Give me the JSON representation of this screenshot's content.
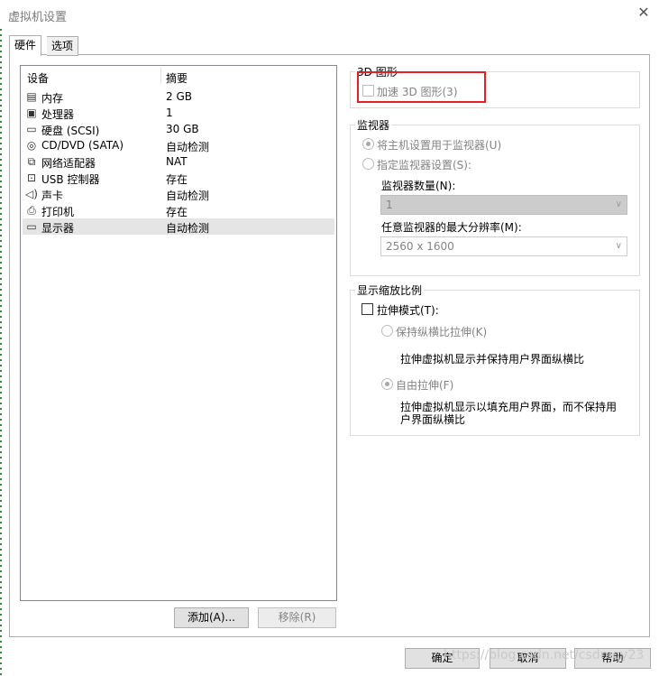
{
  "window": {
    "title": "虚拟机设置"
  },
  "tabs": [
    "硬件",
    "选项"
  ],
  "devices": {
    "col_device": "设备",
    "col_summary": "摘要",
    "rows": [
      {
        "icon": "memory-icon",
        "name": "内存",
        "summary": "2 GB"
      },
      {
        "icon": "cpu-icon",
        "name": "处理器",
        "summary": "1"
      },
      {
        "icon": "hard-disk-icon",
        "name": "硬盘 (SCSI)",
        "summary": "30 GB"
      },
      {
        "icon": "cd-dvd-icon",
        "name": "CD/DVD (SATA)",
        "summary": "自动检测"
      },
      {
        "icon": "network-adapter-icon",
        "name": "网络适配器",
        "summary": "NAT"
      },
      {
        "icon": "usb-icon",
        "name": "USB 控制器",
        "summary": "存在"
      },
      {
        "icon": "sound-card-icon",
        "name": "声卡",
        "summary": "自动检测"
      },
      {
        "icon": "printer-icon",
        "name": "打印机",
        "summary": "存在"
      },
      {
        "icon": "display-icon",
        "name": "显示器",
        "summary": "自动检测"
      }
    ],
    "selected_index": 8,
    "add_button": "添加(A)...",
    "remove_button": "移除(R)"
  },
  "graphics3d": {
    "group_label": "3D 图形",
    "accelerate_label": "加速 3D 图形(3)"
  },
  "monitor": {
    "group_label": "监视器",
    "use_host_label": "将主机设置用于监视器(U)",
    "specify_label": "指定监视器设置(S):",
    "count_label": "监视器数量(N):",
    "count_value": "1",
    "max_res_label": "任意监视器的最大分辨率(M):",
    "max_res_value": "2560 x 1600"
  },
  "scaling": {
    "group_label": "显示缩放比例",
    "stretch_label": "拉伸模式(T):",
    "keep_aspect_label": "保持纵横比拉伸(K)",
    "keep_aspect_desc": "拉伸虚拟机显示并保持用户界面纵横比",
    "free_stretch_label": "自由拉伸(F)",
    "free_stretch_desc_1": "拉伸虚拟机显示以填充用户界面，而不保持用",
    "free_stretch_desc_2": "户界面纵横比"
  },
  "footer": {
    "ok": "确定",
    "cancel": "取消",
    "help": "帮助"
  },
  "watermark": "https://blog.csdn.net/csdmqy23"
}
